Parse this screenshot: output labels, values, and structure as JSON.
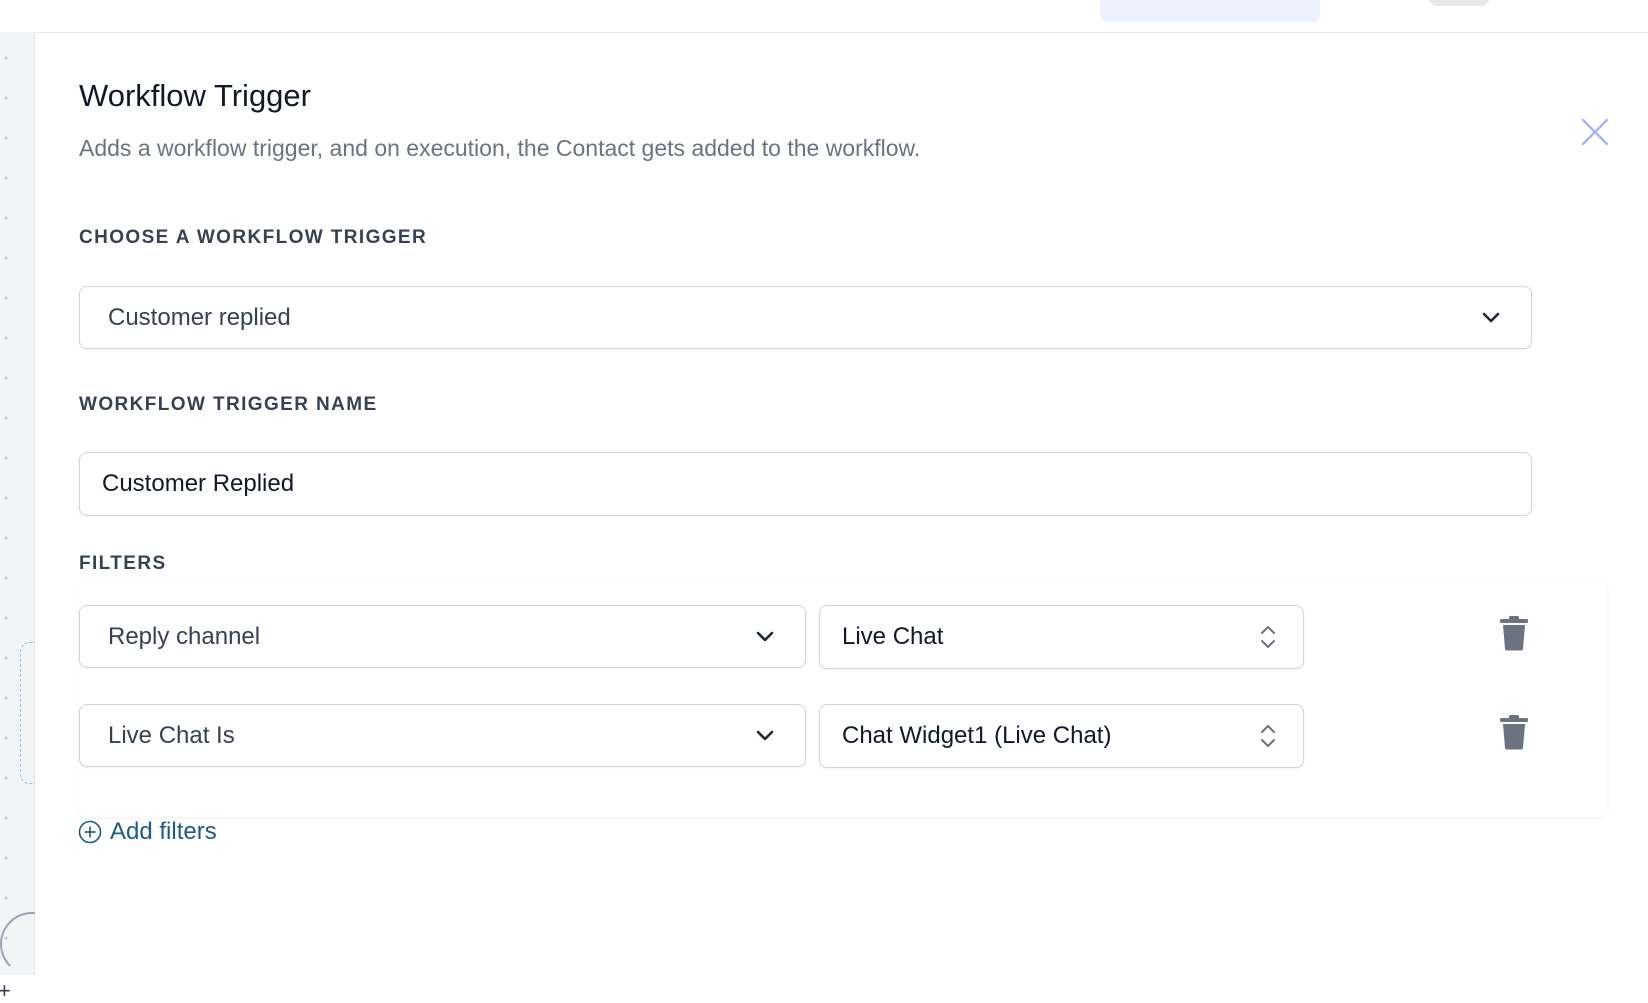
{
  "panel": {
    "title": "Workflow Trigger",
    "description": "Adds a workflow trigger, and on execution, the Contact gets added to the workflow."
  },
  "trigger_select": {
    "label": "CHOOSE A WORKFLOW TRIGGER",
    "value": "Customer replied"
  },
  "trigger_name": {
    "label": "WORKFLOW TRIGGER NAME",
    "value": "Customer Replied"
  },
  "filters": {
    "label": "FILTERS",
    "rows": [
      {
        "field": "Reply channel",
        "value": "Live Chat"
      },
      {
        "field": "Live Chat Is",
        "value": "Chat Widget1 (Live Chat)"
      }
    ],
    "add_label": "Add filters"
  },
  "colors": {
    "accent_link": "#1e5a86",
    "close_icon": "#a5b4fc",
    "trash_icon": "#6b7280"
  }
}
